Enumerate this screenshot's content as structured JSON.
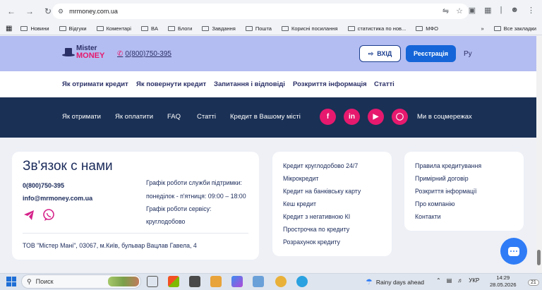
{
  "browser": {
    "url": "mrmoney.com.ua",
    "bookmarks": [
      "Новини",
      "Відгуки",
      "Коментарі",
      "BA",
      "Блоги",
      "Завдання",
      "Пошта",
      "Корисні посилання",
      "статистика по нов...",
      "МФО"
    ],
    "all_bookmarks": "Все закладки"
  },
  "header": {
    "logo_top": "Mister",
    "logo_bottom": "MONEY",
    "phone": "0(800)750-395",
    "login_label": "ВХІД",
    "register_label": "Реєстрація",
    "lang": "Ру"
  },
  "menu": [
    "Як отримати кредит",
    "Як повернути кредит",
    "Запитання і відповіді",
    "Розкриття інформація",
    "Статті"
  ],
  "footer_nav": {
    "links": [
      "Як отримати",
      "Як оплатити",
      "FAQ",
      "Статті",
      "Кредит в Вашому місті"
    ],
    "social_label": "Ми в соцмережах",
    "social_icons": [
      "facebook-icon",
      "linkedin-icon",
      "youtube-icon",
      "instagram-icon"
    ]
  },
  "contact": {
    "title": "Зв'язок с нами",
    "phone": "0(800)750-395",
    "email": "info@mrmoney.com.ua",
    "support_hours_title": "Графік роботи служби підтримки:",
    "support_hours": "понеділок - п'ятниця: 09:00 – 18:00",
    "service_hours_title": "Графік роботи сервісу:",
    "service_hours": "круглодобово",
    "address": "ТОВ \"Містер Мані\", 03067, м.Київ, бульвар Вацлав Гавела, 4",
    "messenger_icons": [
      "telegram-icon",
      "viber-icon"
    ]
  },
  "credit_links": [
    "Кредит круглодобово 24/7",
    "Мікрокредит",
    "Кредит на банківську карту",
    "Кеш кредит",
    "Кредит з негативною КІ",
    "Прострочка по кредиту",
    "Розрахунок кредиту"
  ],
  "info_links": [
    "Правила кредитування",
    "Примірний договір",
    "Розкриття інформації",
    "Про компанію",
    "Контакти"
  ],
  "taskbar": {
    "search": "Поиск",
    "weather": "Rainy days ahead",
    "lang": "УКР",
    "time": "14:29",
    "date": "28.05.2026",
    "notif_count": "21"
  },
  "colors": {
    "header_bg": "#b4bdf1",
    "brand_dark": "#1a3055",
    "brand_pink": "#e6196e",
    "register_blue": "#1565d8"
  }
}
